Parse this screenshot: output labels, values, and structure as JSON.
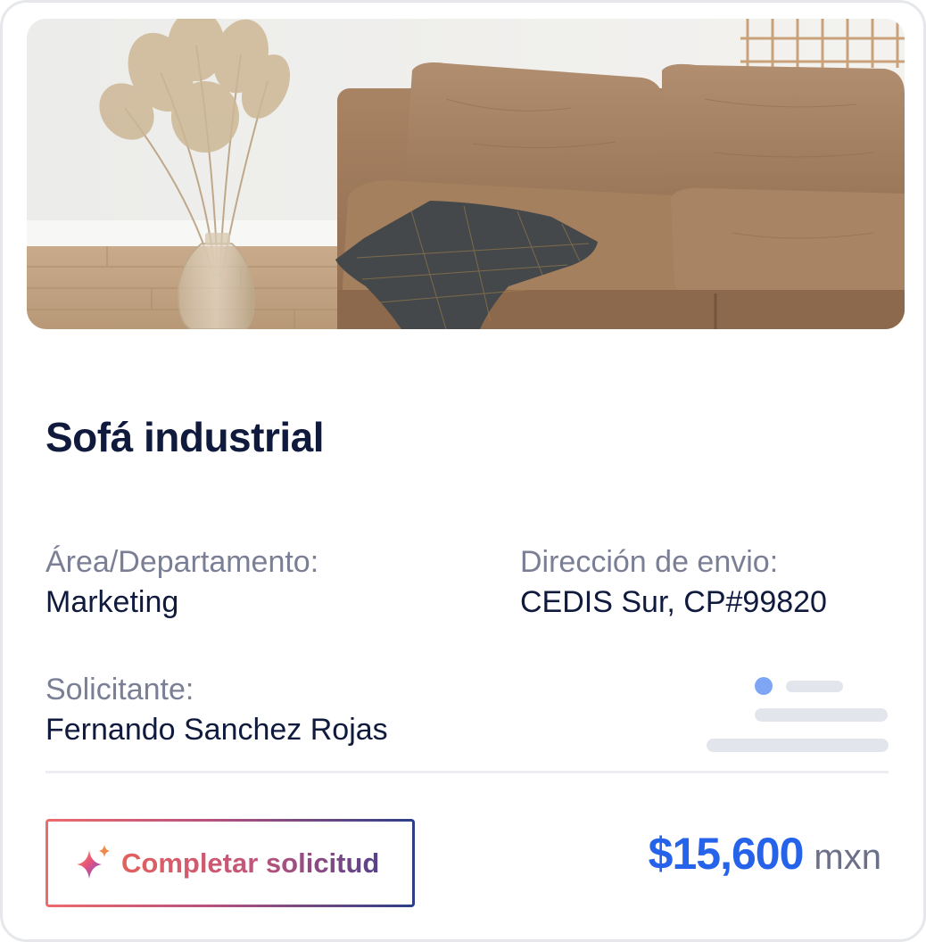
{
  "product": {
    "title": "Sofá industrial",
    "image_alt": "sofa-photo"
  },
  "details": {
    "area_label": "Área/Departamento:",
    "area_value": "Marketing",
    "address_label": "Dirección de envio:",
    "address_value": "CEDIS Sur, CP#99820",
    "requester_label": "Solicitante:",
    "requester_value": "Fernando Sanchez Rojas"
  },
  "action": {
    "label": "Completar solicitud",
    "icon": "sparkle-icon"
  },
  "price": {
    "amount": "$15,600",
    "currency": "mxn"
  },
  "colors": {
    "title": "#0f1a3d",
    "label": "#7a7f95",
    "price": "#2563eb",
    "skeleton_accent": "#7ea6f4",
    "skeleton_line": "#e2e6ec"
  }
}
